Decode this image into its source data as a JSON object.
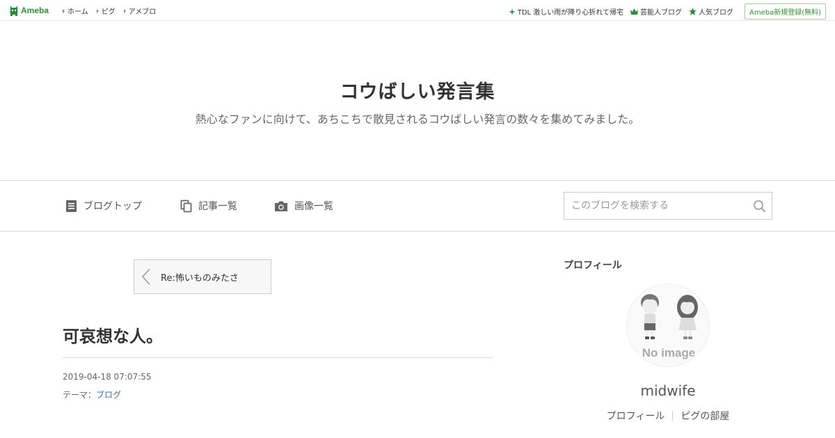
{
  "topbar": {
    "logo_text": "Ameba",
    "nav": [
      "ホーム",
      "ピグ",
      "アメブロ"
    ],
    "links": [
      {
        "label": "TDL 激しい雨が降り心折れて帰宅",
        "icon": "sparkle-icon"
      },
      {
        "label": "芸能人ブログ",
        "icon": "crown-icon"
      },
      {
        "label": "人気ブログ",
        "icon": "star-icon"
      }
    ],
    "signup_label": "Ameba新規登録(無料)",
    "accent_color": "#2d8c3c"
  },
  "header": {
    "title": "コウばしい発言集",
    "description": "熱心なファンに向けて、あちこちで散見されるコウばしい発言の数々を集めてみました。"
  },
  "nav": {
    "items": [
      {
        "label": "ブログトップ",
        "icon": "document-icon"
      },
      {
        "label": "記事一覧",
        "icon": "copy-icon"
      },
      {
        "label": "画像一覧",
        "icon": "camera-icon"
      }
    ],
    "search_placeholder": "このブログを検索する"
  },
  "main": {
    "prev_entry_label": "Re:怖いものみたさ",
    "entry_title": "可哀想な人。",
    "entry_date": "2019-04-18 07:07:55",
    "theme_prefix": "テーマ：",
    "theme_link": "ブログ"
  },
  "sidebar": {
    "heading": "プロフィール",
    "avatar_label": "No image",
    "nickname": "midwife",
    "links": [
      "プロフィール",
      "ピグの部屋"
    ]
  }
}
